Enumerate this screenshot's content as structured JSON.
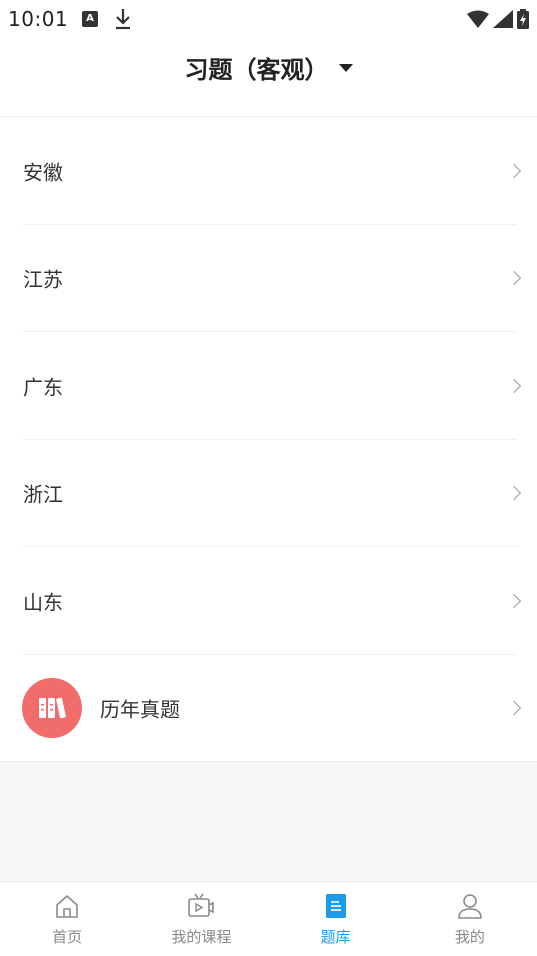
{
  "status_bar": {
    "time": "10:01",
    "a_icon_letter": "A"
  },
  "header": {
    "title": "习题（客观）"
  },
  "list": {
    "items": [
      {
        "label": "安徽"
      },
      {
        "label": "江苏"
      },
      {
        "label": "广东"
      },
      {
        "label": "浙江"
      },
      {
        "label": "山东"
      }
    ],
    "special_item": {
      "label": "历年真题",
      "icon": "books-icon",
      "icon_color": "#f06d6c"
    }
  },
  "bottom_nav": {
    "items": [
      {
        "label": "首页",
        "icon": "home-icon",
        "active": false
      },
      {
        "label": "我的课程",
        "icon": "tv-icon",
        "active": false
      },
      {
        "label": "题库",
        "icon": "document-icon",
        "active": true
      },
      {
        "label": "我的",
        "icon": "user-icon",
        "active": false
      }
    ],
    "active_color": "#1e9be8",
    "inactive_color": "#8a8a8a"
  }
}
